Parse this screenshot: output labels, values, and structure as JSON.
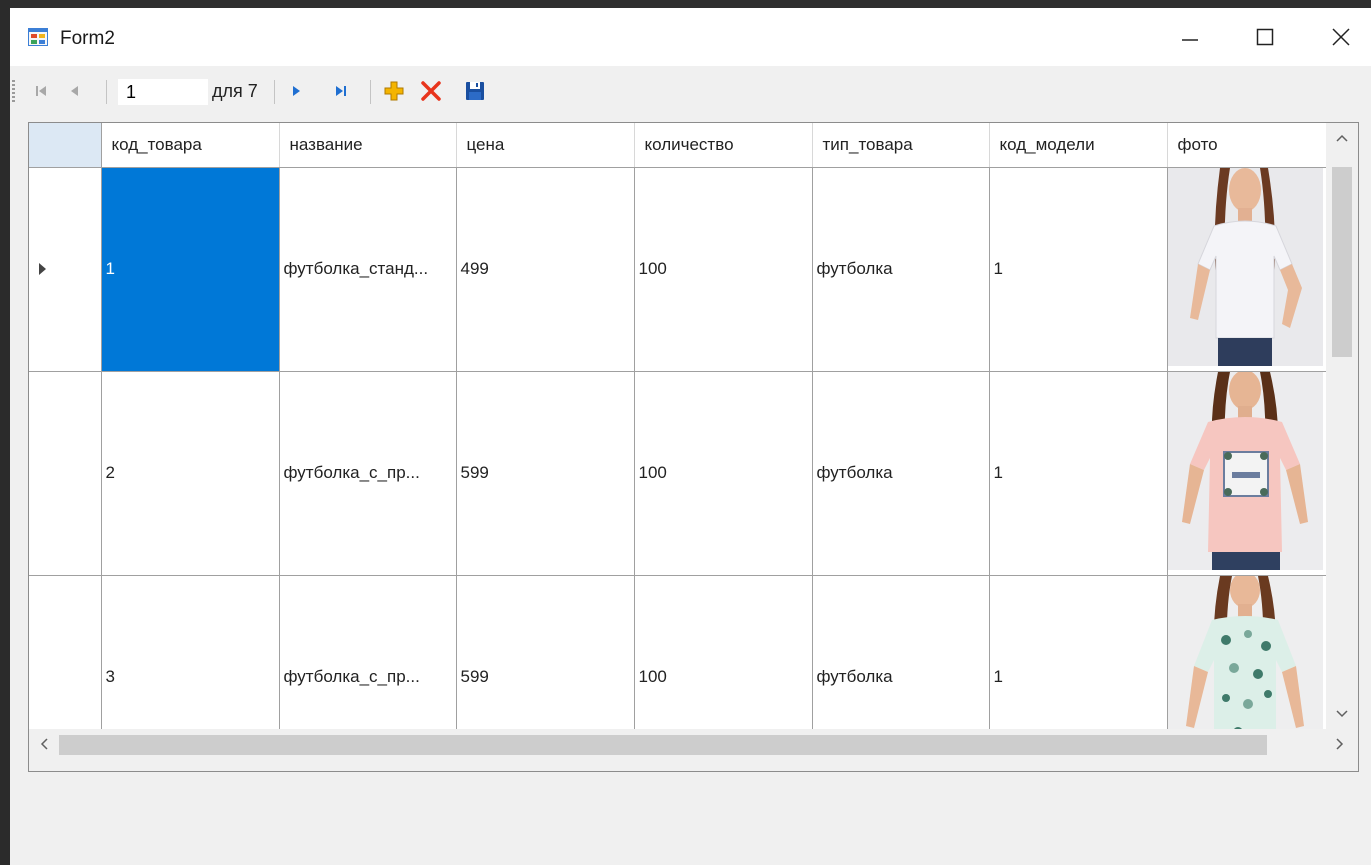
{
  "window": {
    "title": "Form2"
  },
  "navigator": {
    "position_value": "1",
    "count_label": "для 7",
    "icons": [
      "move-first-icon",
      "move-previous-icon",
      "move-next-icon",
      "move-last-icon",
      "add-new-icon",
      "delete-icon",
      "save-icon"
    ],
    "colors": {
      "add": "#f4b400",
      "delete": "#e8341c",
      "nav": "#1f6fd1",
      "save": "#1a4fa0"
    }
  },
  "grid": {
    "columns": [
      "код_товара",
      "название",
      "цена",
      "количество",
      "тип_товара",
      "код_модели",
      "фото"
    ],
    "rows": [
      {
        "cells": [
          "1",
          "футболка_станд...",
          "499",
          "100",
          "футболка",
          "1"
        ],
        "photo": "white-tshirt-photo"
      },
      {
        "cells": [
          "2",
          "футболка_с_пр...",
          "599",
          "100",
          "футболка",
          "1"
        ],
        "photo": "pink-printed-tshirt-photo"
      },
      {
        "cells": [
          "3",
          "футболка_с_пр...",
          "599",
          "100",
          "футболка",
          "1"
        ],
        "photo": "floral-tshirt-photo"
      }
    ],
    "selected_row": 0,
    "selected_color": "#0078d7"
  }
}
